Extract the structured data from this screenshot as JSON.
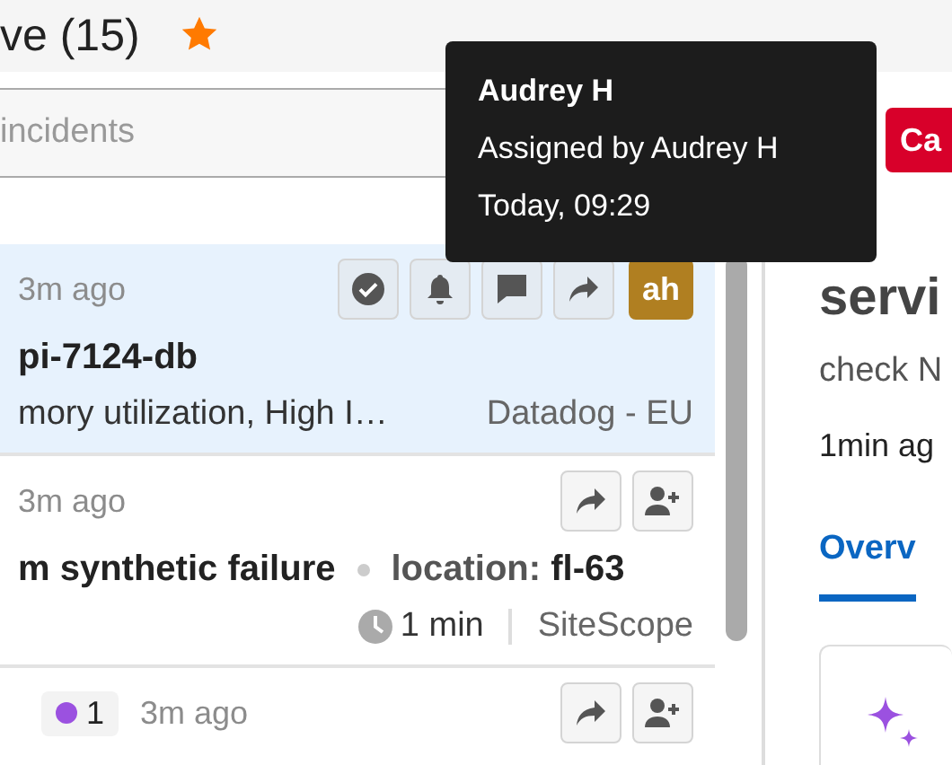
{
  "header": {
    "title": "ve (15)",
    "starred": true
  },
  "search": {
    "placeholder": "incidents"
  },
  "create_button": {
    "label": "Ca"
  },
  "incidents": [
    {
      "selected": true,
      "time": "3m ago",
      "actions": [
        {
          "kind": "acknowledge"
        },
        {
          "kind": "snooze"
        },
        {
          "kind": "comment"
        },
        {
          "kind": "forward"
        }
      ],
      "assignee": "ah",
      "title": "pi-7124-db",
      "summary": "mory utilization, High I…",
      "source": "Datadog - EU"
    },
    {
      "selected": false,
      "time": "3m ago",
      "actions": [
        {
          "kind": "forward"
        },
        {
          "kind": "assign"
        }
      ],
      "title": "m synthetic failure",
      "tag_key": "location:",
      "tag_value": "fl-63",
      "duration": "1 min",
      "source": "SiteScope"
    },
    {
      "selected": false,
      "badge": {
        "count": "1",
        "color": "#9b51e0"
      },
      "time": "3m ago",
      "actions": [
        {
          "kind": "forward"
        },
        {
          "kind": "assign"
        }
      ]
    }
  ],
  "detail": {
    "title": "servi",
    "description": "check N",
    "time": "1min ag",
    "tabs": [
      {
        "label": "Overv",
        "selected": true
      }
    ]
  },
  "tooltip": {
    "name": "Audrey H",
    "line": "Assigned by Audrey H",
    "time": "Today, 09:29"
  }
}
